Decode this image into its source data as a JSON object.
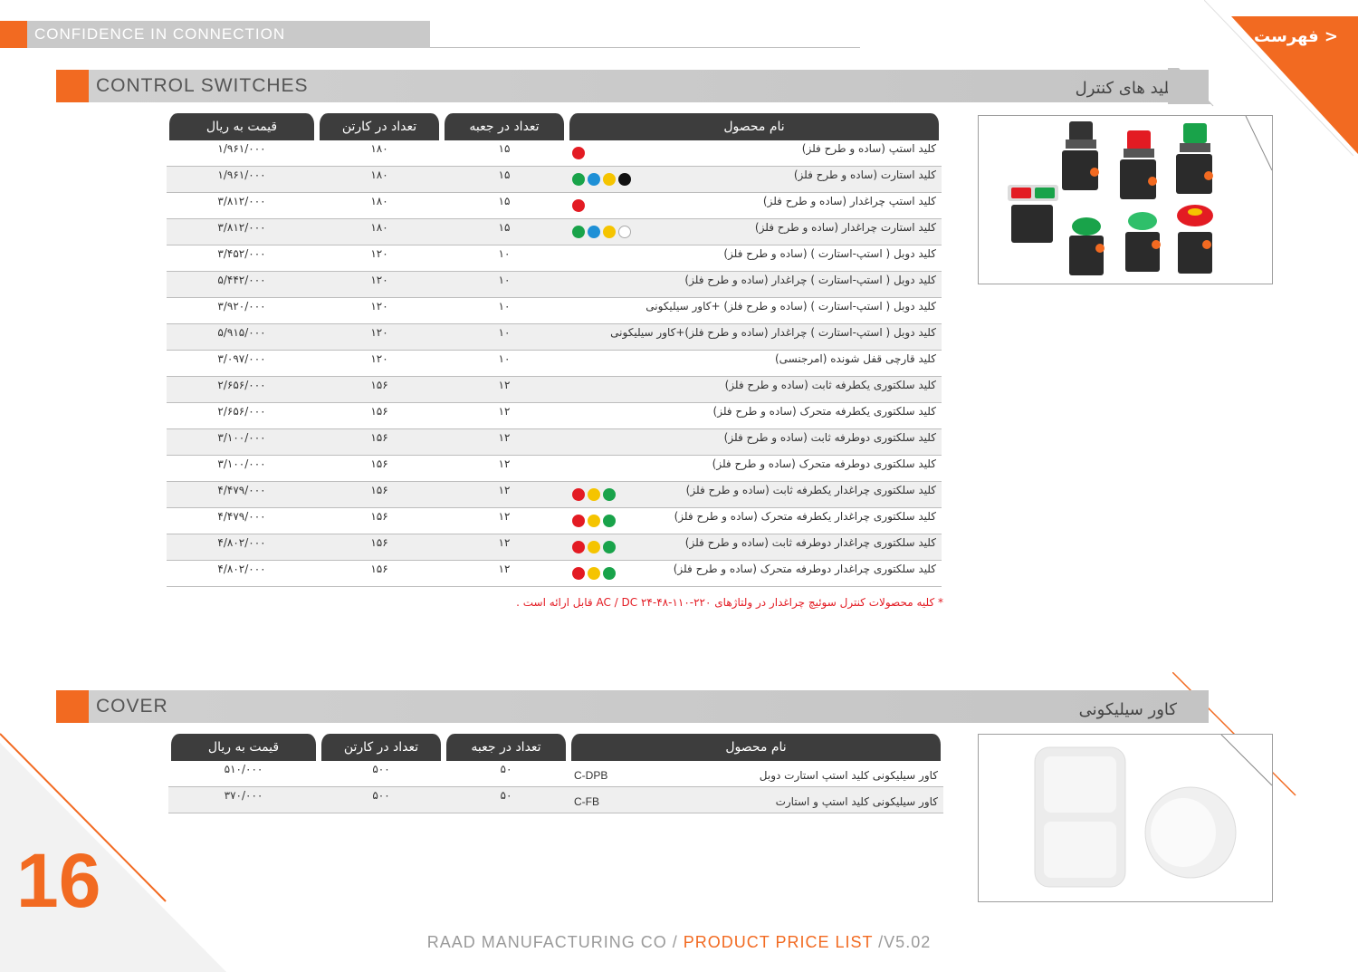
{
  "brand": {
    "tagline": "CONFIDENCE IN CONNECTION"
  },
  "nav": {
    "toc_label": "< فهرست"
  },
  "colors": {
    "accent": "#f26a21",
    "header_bg": "#3d3d3d",
    "red": "#e31b23",
    "green": "#19a34a",
    "blue": "#1e90d6",
    "yellow": "#f5c400",
    "black": "#111111",
    "white": "#ffffff"
  },
  "control_switches": {
    "title_en": "CONTROL SWITCHES",
    "title_fa": "کلید های کنترل",
    "columns": {
      "name": "نام محصول",
      "per_box": "تعداد در جعبه",
      "per_carton": "تعداد در کارتن",
      "price": "قیمت به ریال"
    },
    "rows": [
      {
        "name": "کلید استپ (ساده و طرح فلز)",
        "per_box": "۱۵",
        "per_carton": "۱۸۰",
        "price": "۱/۹۶۱/۰۰۰",
        "colors": [
          "red"
        ]
      },
      {
        "name": "کلید استارت (ساده و طرح فلز)",
        "per_box": "۱۵",
        "per_carton": "۱۸۰",
        "price": "۱/۹۶۱/۰۰۰",
        "colors": [
          "green",
          "blue",
          "yellow",
          "black"
        ]
      },
      {
        "name": "کلید استپ چراغدار (ساده و طرح فلز)",
        "per_box": "۱۵",
        "per_carton": "۱۸۰",
        "price": "۳/۸۱۲/۰۰۰",
        "colors": [
          "red"
        ]
      },
      {
        "name": "کلید استارت چراغدار (ساده و طرح فلز)",
        "per_box": "۱۵",
        "per_carton": "۱۸۰",
        "price": "۳/۸۱۲/۰۰۰",
        "colors": [
          "green",
          "blue",
          "yellow",
          "white"
        ]
      },
      {
        "name": "کلید دوبل ( استپ-استارت ) (ساده و طرح فلز)",
        "per_box": "۱۰",
        "per_carton": "۱۲۰",
        "price": "۳/۴۵۲/۰۰۰",
        "colors": []
      },
      {
        "name": "کلید دوبل ( استپ-استارت ) چراغدار (ساده و طرح فلز)",
        "per_box": "۱۰",
        "per_carton": "۱۲۰",
        "price": "۵/۴۴۲/۰۰۰",
        "colors": []
      },
      {
        "name": "کلید دوبل ( استپ-استارت ) (ساده و طرح فلز) +کاور سیلیکونی",
        "per_box": "۱۰",
        "per_carton": "۱۲۰",
        "price": "۳/۹۲۰/۰۰۰",
        "colors": []
      },
      {
        "name": "کلید دوبل ( استپ-استارت ) چراغدار (ساده و طرح فلز)+کاور سیلیکونی",
        "per_box": "۱۰",
        "per_carton": "۱۲۰",
        "price": "۵/۹۱۵/۰۰۰",
        "colors": []
      },
      {
        "name": "کلید قارچی قفل شونده (امرجنسی)",
        "per_box": "۱۰",
        "per_carton": "۱۲۰",
        "price": "۳/۰۹۷/۰۰۰",
        "colors": []
      },
      {
        "name": "کلید سلکتوری یکطرفه ثابت (ساده و طرح فلز)",
        "per_box": "۱۲",
        "per_carton": "۱۵۶",
        "price": "۲/۶۵۶/۰۰۰",
        "colors": []
      },
      {
        "name": "کلید سلکتوری یکطرفه متحرک (ساده و طرح فلز)",
        "per_box": "۱۲",
        "per_carton": "۱۵۶",
        "price": "۲/۶۵۶/۰۰۰",
        "colors": []
      },
      {
        "name": "کلید سلکتوری دوطرفه ثابت (ساده و طرح فلز)",
        "per_box": "۱۲",
        "per_carton": "۱۵۶",
        "price": "۳/۱۰۰/۰۰۰",
        "colors": []
      },
      {
        "name": "کلید سلکتوری دوطرفه متحرک (ساده و طرح فلز)",
        "per_box": "۱۲",
        "per_carton": "۱۵۶",
        "price": "۳/۱۰۰/۰۰۰",
        "colors": []
      },
      {
        "name": "کلید سلکتوری چراغدار یکطرفه ثابت (ساده و طرح فلز)",
        "per_box": "۱۲",
        "per_carton": "۱۵۶",
        "price": "۴/۴۷۹/۰۰۰",
        "colors": [
          "red",
          "yellow",
          "green"
        ]
      },
      {
        "name": "کلید سلکتوری چراغدار یکطرفه متحرک (ساده و طرح فلز)",
        "per_box": "۱۲",
        "per_carton": "۱۵۶",
        "price": "۴/۴۷۹/۰۰۰",
        "colors": [
          "red",
          "yellow",
          "green"
        ]
      },
      {
        "name": "کلید سلکتوری چراغدار دوطرفه ثابت (ساده و طرح فلز)",
        "per_box": "۱۲",
        "per_carton": "۱۵۶",
        "price": "۴/۸۰۲/۰۰۰",
        "colors": [
          "red",
          "yellow",
          "green"
        ]
      },
      {
        "name": "کلید سلکتوری چراغدار دوطرفه متحرک (ساده و طرح فلز)",
        "per_box": "۱۲",
        "per_carton": "۱۵۶",
        "price": "۴/۸۰۲/۰۰۰",
        "colors": [
          "red",
          "yellow",
          "green"
        ]
      }
    ],
    "footnote": "* کلیه محصولات کنترل سوئیچ چراغدار در ولتاژهای ۲۲۰-۱۱۰-۴۸-۲۴ AC / DC قابل ارائه است ."
  },
  "cover": {
    "title_en": "COVER",
    "title_fa": "کاور سیلیکونی",
    "columns": {
      "name": "نام محصول",
      "per_box": "تعداد در جعبه",
      "per_carton": "تعداد در کارتن",
      "price": "قیمت به ریال"
    },
    "rows": [
      {
        "name": "کاور سیلیکونی کلید استپ استارت دوبل",
        "code": "C-DPB",
        "per_box": "۵۰",
        "per_carton": "۵۰۰",
        "price": "۵۱۰/۰۰۰"
      },
      {
        "name": "کاور سیلیکونی کلید استپ و استارت",
        "code": "C-FB",
        "per_box": "۵۰",
        "per_carton": "۵۰۰",
        "price": "۳۷۰/۰۰۰"
      }
    ]
  },
  "footer": {
    "company": "RAAD MANUFACTURING CO / ",
    "list_name": "PRODUCT PRICE LIST",
    "version": " /V5.02"
  },
  "page_number": "16"
}
